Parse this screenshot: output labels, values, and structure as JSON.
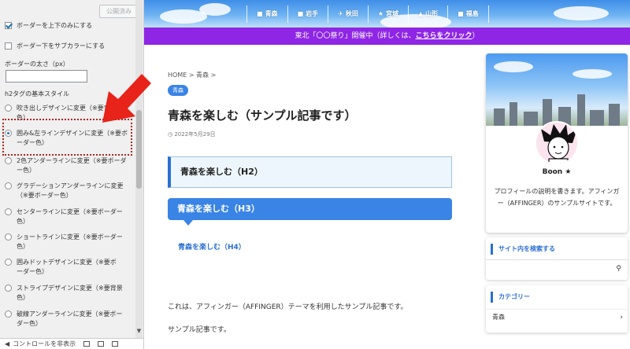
{
  "customizer": {
    "publish_label": "公開済み",
    "check_top_bottom": "ボーダーを上下のみにする",
    "check_sub_color": "ボーダー下をサブカラーにする",
    "border_width_label": "ボーダーの太さ（px）",
    "border_width_value": "",
    "h2_style_label": "h2タグの基本スタイル",
    "options": [
      {
        "line1": "吹き出しデザインに変更（※要背景",
        "line2": "色）"
      },
      {
        "line1": "囲み&左ラインデザインに変更（※要ボ",
        "line2": "ーダー色）"
      },
      {
        "line1": "2色アンダーラインに変更（※要ボーダ",
        "line2": "ー色）"
      },
      {
        "line1": "グラデーションアンダーラインに変更",
        "line2": "（※要ボーダー色）"
      },
      {
        "line1": "センターラインに変更（※要ボーダー",
        "line2": "色）"
      },
      {
        "line1": "ショートラインに変更（※要ボーダー",
        "line2": "色）"
      },
      {
        "line1": "囲みドットデザインに変更（※要ボ",
        "line2": "ーダー色）"
      },
      {
        "line1": "ストライプデザインに変更（※要背景",
        "line2": "色）"
      },
      {
        "line1": "破線アンダーラインに変更（※要ボー",
        "line2": "ダー色）"
      }
    ],
    "selected_index": 1,
    "footer_label": "コントロールを非表示"
  },
  "header": {
    "nav": [
      {
        "icon": "■",
        "label": "青森"
      },
      {
        "icon": "■",
        "label": "岩手"
      },
      {
        "icon": "✈",
        "label": "秋田"
      },
      {
        "icon": "★",
        "label": "宮城"
      },
      {
        "icon": "▲",
        "label": "山形"
      },
      {
        "icon": "■",
        "label": "福島"
      }
    ],
    "notice_text": "東北「〇〇祭り」開催中（詳しくは、",
    "notice_link": "こちらをクリック",
    "notice_end": "）"
  },
  "article": {
    "breadcrumb": "HOME > 青森 >",
    "category": "青森",
    "title": "青森を楽しむ（サンプル記事です）",
    "date": "2022年5月29日",
    "h2": "青森を楽しむ（H2）",
    "h3": "青森を楽しむ（H3）",
    "h4": "青森を楽しむ（H4）",
    "body1": "これは、アフィンガー（AFFINGER）テーマを利用したサンプル記事です。",
    "body2": "サンプル記事です。"
  },
  "sidebar": {
    "profile_name": "Boon ★",
    "profile_desc": "プロフィールの説明を書きます。アフィンガー（AFFINGER）のサンプルサイトです。",
    "search_title": "サイト内を検索する",
    "category_title": "カテゴリー",
    "category_item": "青森"
  },
  "colors": {
    "notice_bg": "#8f26e5",
    "accent_blue": "#3a84e6",
    "highlight_red": "#b2221a",
    "arrow_red": "#e8231a"
  }
}
